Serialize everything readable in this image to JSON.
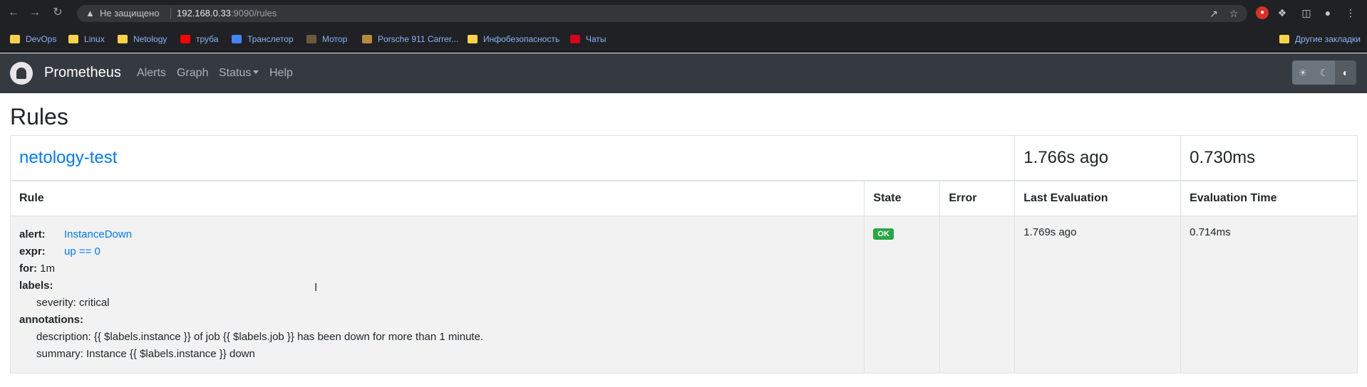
{
  "browser": {
    "security_text": "Не защищено",
    "url_host": "192.168.0.33",
    "url_rest": ":9090/rules",
    "other_bookmarks": "Другие закладки",
    "bookmarks": [
      {
        "label": "DevOps",
        "icon": "folder-icon"
      },
      {
        "label": "Linux",
        "icon": "folder-icon"
      },
      {
        "label": "Netology",
        "icon": "folder-icon"
      },
      {
        "label": "труба",
        "icon": "youtube-icon"
      },
      {
        "label": "Транслетор",
        "icon": "translate-icon"
      },
      {
        "label": "Мотор",
        "icon": "motor-icon"
      },
      {
        "label": "Porsche 911 Carrer...",
        "icon": "porsche-icon"
      },
      {
        "label": "Инфобезопасность",
        "icon": "folder-icon"
      },
      {
        "label": "Чаты",
        "icon": "hh-icon"
      }
    ]
  },
  "navbar": {
    "brand": "Prometheus",
    "links": [
      "Alerts",
      "Graph",
      "Status",
      "Help"
    ]
  },
  "page": {
    "title": "Rules",
    "group": {
      "name": "netology-test",
      "last_evaluation": "1.766s ago",
      "evaluation_time": "0.730ms"
    },
    "columns": [
      "Rule",
      "State",
      "Error",
      "Last Evaluation",
      "Evaluation Time"
    ],
    "rule": {
      "alert_key": "alert:",
      "alert_value": "InstanceDown",
      "expr_key": "expr:",
      "expr_value": "up == 0",
      "for_key": "for:",
      "for_value": "1m",
      "labels_key": "labels:",
      "label_severity": "severity: critical",
      "annotations_key": "annotations:",
      "annotation_description": "description: {{ $labels.instance }} of job {{ $labels.job }} has been down for more than 1 minute.",
      "annotation_summary": "summary: Instance {{ $labels.instance }} down",
      "state": "OK",
      "error": "",
      "last_evaluation": "1.769s ago",
      "evaluation_time": "0.714ms"
    }
  },
  "colors": {
    "navbar_bg": "#343a40",
    "link": "#007bff",
    "badge_ok": "#28a745",
    "row_bg": "#f2f2f2"
  }
}
